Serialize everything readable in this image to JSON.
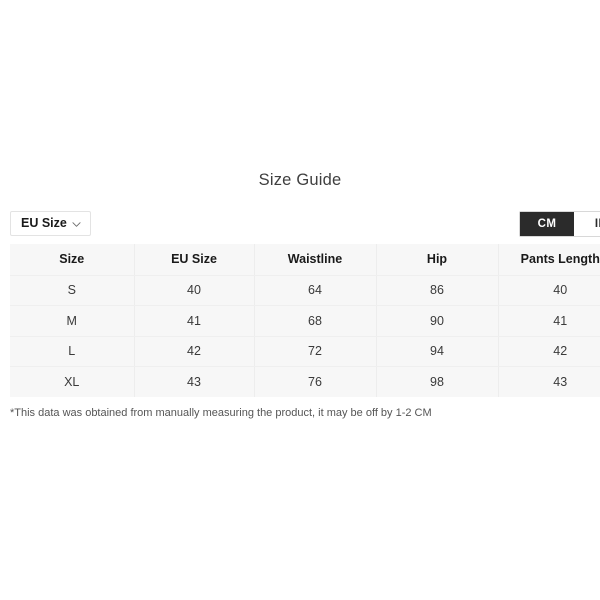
{
  "widget": {
    "title": "Size Guide"
  },
  "controls": {
    "size_system_dropdown": {
      "selected": "EU Size",
      "chevron_icon": "chevron-down-icon"
    },
    "unit_toggle": {
      "options": [
        {
          "label": "CM",
          "active": true
        },
        {
          "label": "IN",
          "active": false
        }
      ]
    }
  },
  "table": {
    "columns": [
      "Size",
      "EU Size",
      "Waistline",
      "Hip",
      "Pants Length"
    ],
    "rows": [
      [
        "S",
        "40",
        "64",
        "86",
        "40"
      ],
      [
        "M",
        "41",
        "68",
        "90",
        "41"
      ],
      [
        "L",
        "42",
        "72",
        "94",
        "42"
      ],
      [
        "XL",
        "43",
        "76",
        "98",
        "43"
      ]
    ]
  },
  "footnote": {
    "text": "*This data was obtained from manually measuring the product, it may be off by 1-2 CM"
  },
  "colors": {
    "page_background": "#ffffff",
    "table_background": "#f7f7f7",
    "cell_border": "#ededed",
    "toggle_active_background": "#2b2b2b",
    "toggle_active_text": "#ffffff",
    "title_text": "#3f3f3f",
    "header_text": "#1a1a1a",
    "cell_text": "#3a3a3a",
    "footnote_text": "#555555",
    "dropdown_border": "#e3e3e3"
  }
}
